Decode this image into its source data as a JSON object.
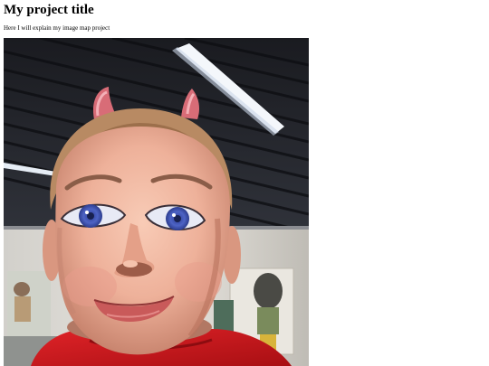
{
  "page": {
    "title": "My project title",
    "description": "Here I will explain my image map project"
  },
  "image": {
    "subject": "giant-head-sculpture-photo",
    "colors": {
      "ceiling": "#1d1f26",
      "wall": "#d9d6cf",
      "skin": "#f0b8a1",
      "skin_shadow": "#c8866e",
      "hair": "#b88a63",
      "horns": "#d86c77",
      "iris": "#3f55b7",
      "lips": "#c95a5a",
      "shirt": "#c9171c"
    }
  }
}
